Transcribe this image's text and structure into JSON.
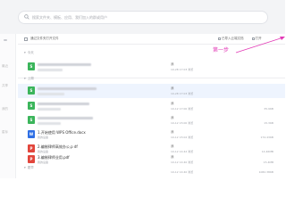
{
  "search": {
    "placeholder": "搜索文件夹、模板、应用、我们加入的群或用户"
  },
  "left_pane": {
    "items": [
      "最近",
      "共享",
      "我的",
      "星标"
    ]
  },
  "toolbar": {
    "left_label": "通过文件夹打开文件",
    "right_upload_label": "已导入云端文档",
    "right_action_label": "打开"
  },
  "groups": [
    {
      "label": "今天"
    },
    {
      "label": "上周"
    },
    {
      "label": "更早"
    }
  ],
  "annotation": {
    "text": "第一步",
    "color": "#e23ab6"
  },
  "colors": {
    "xls": "#3bb55b",
    "doc": "#2f6fe4",
    "pdf": "#e2463c",
    "selected_row": "#eef4fe"
  },
  "files": [
    {
      "type": "xls",
      "icon": "xls-icon",
      "name": "",
      "location": "",
      "owner": "我",
      "time": "10-28 17:03 浏览",
      "size": ""
    },
    {
      "type": "xls",
      "icon": "xls-icon",
      "name": "",
      "location": "",
      "owner": "我",
      "time": "10-28 17:03 浏览",
      "size": ""
    },
    {
      "type": "xls",
      "icon": "xls-icon",
      "name": "",
      "location": "",
      "owner": "我",
      "time": "10-12 17:00 浏览",
      "size": "35.9KB"
    },
    {
      "type": "xls",
      "icon": "xls-icon",
      "name": "",
      "location": "",
      "owner": "我",
      "time": "10-12 15:00 浏览",
      "size": "15.3KB"
    },
    {
      "type": "doc",
      "icon": "doc-icon",
      "name": "1.开始使用 WPS Office.docx",
      "location": "我的设备",
      "owner": "我",
      "time": "10-12 15:02 浏览",
      "size": "174.43KB"
    },
    {
      "type": "pdf",
      "icon": "pdf-icon",
      "name": "2.编制律师高效办公.p df",
      "location": "我的设备",
      "owner": "我",
      "time": "10-12 14:42 浏览",
      "size": "14.46MB"
    },
    {
      "type": "pdf",
      "icon": "pdf-icon",
      "name": "3.编制律师业用.pdf",
      "location": "我的设备",
      "owner": "我",
      "time": "10-12 14:40 浏览",
      "size": "15.4MB"
    },
    {
      "type": "xls",
      "icon": "xls-icon",
      "name": "",
      "location": "",
      "owner": "我",
      "time": "10-12 14:40 浏览",
      "size": "1082.38KB"
    }
  ]
}
